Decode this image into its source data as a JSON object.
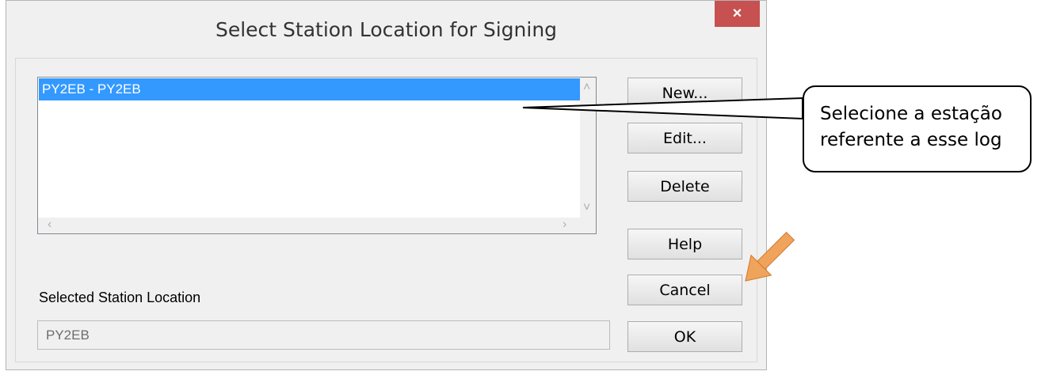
{
  "dialog": {
    "title": "Select Station Location for Signing",
    "close_glyph": "×"
  },
  "list": {
    "items": [
      {
        "label": "PY2EB - PY2EB",
        "selected": true
      }
    ]
  },
  "buttons": {
    "new_label": "New...",
    "edit_label": "Edit...",
    "delete_label": "Delete",
    "help_label": "Help",
    "cancel_label": "Cancel",
    "ok_label": "OK"
  },
  "selected_station": {
    "label": "Selected Station Location",
    "value": "PY2EB"
  },
  "callout": {
    "line1": "Selecione a estação",
    "line2": "referente a esse log"
  },
  "colors": {
    "selection": "#3399ff",
    "close_button": "#c75050",
    "arrow": "#f0a35a"
  },
  "icons": {
    "close": "close-icon",
    "scroll_up": "chevron-up-icon",
    "scroll_down": "chevron-down-icon",
    "scroll_left": "chevron-left-icon",
    "scroll_right": "chevron-right-icon",
    "annotation_arrow": "arrow-down-left-icon"
  }
}
